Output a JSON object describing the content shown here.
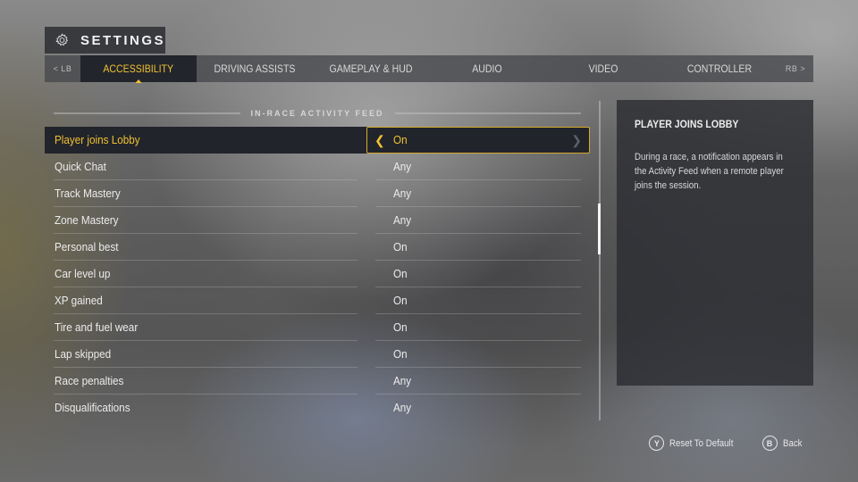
{
  "header": {
    "title": "SETTINGS",
    "icon": "gear-icon"
  },
  "tabs": {
    "left_bumper": "< LB",
    "right_bumper": "RB >",
    "items": [
      {
        "label": "ACCESSIBILITY",
        "active": true
      },
      {
        "label": "DRIVING ASSISTS",
        "active": false
      },
      {
        "label": "GAMEPLAY & HUD",
        "active": false
      },
      {
        "label": "AUDIO",
        "active": false
      },
      {
        "label": "VIDEO",
        "active": false
      },
      {
        "label": "CONTROLLER",
        "active": false
      }
    ]
  },
  "section": {
    "title": "IN-RACE ACTIVITY FEED"
  },
  "settings": [
    {
      "label": "Player joins Lobby",
      "value": "On",
      "selected": true
    },
    {
      "label": "Quick Chat",
      "value": "Any"
    },
    {
      "label": "Track Mastery",
      "value": "Any"
    },
    {
      "label": "Zone Mastery",
      "value": "Any"
    },
    {
      "label": "Personal best",
      "value": "On"
    },
    {
      "label": "Car level up",
      "value": "On"
    },
    {
      "label": "XP gained",
      "value": "On"
    },
    {
      "label": "Tire and fuel wear",
      "value": "On"
    },
    {
      "label": "Lap skipped",
      "value": "On"
    },
    {
      "label": "Race penalties",
      "value": "Any"
    },
    {
      "label": "Disqualifications",
      "value": "Any"
    }
  ],
  "description": {
    "title": "PLAYER JOINS LOBBY",
    "body": "During a race, a notification appears in the Activity Feed when a remote player joins the session."
  },
  "footer": {
    "reset": {
      "button": "Y",
      "label": "Reset To Default"
    },
    "back": {
      "button": "B",
      "label": "Back"
    }
  },
  "colors": {
    "accent": "#f1c232",
    "selected_bg": "#22242b",
    "panel_bg": "#2c2d32"
  }
}
